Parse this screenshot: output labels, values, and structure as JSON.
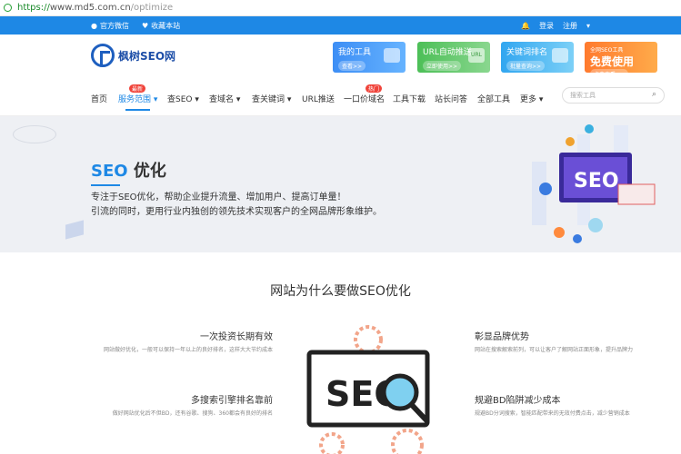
{
  "browser": {
    "url_proto": "https://",
    "url_host": "www.md5.com.cn",
    "url_path": "/optimize"
  },
  "topbar": {
    "wechat": "官方微信",
    "bookmark": "收藏本站",
    "login": "登录",
    "register": "注册"
  },
  "logo": {
    "text": "枫树SEO网"
  },
  "promos": [
    {
      "title": "我的工具",
      "sub": "查看>>"
    },
    {
      "title": "URL自动推送",
      "sub": "立即使用>>",
      "art": "URL"
    },
    {
      "title": "关键词排名",
      "sub": "批量查询>>"
    },
    {
      "title": "免费使用",
      "sub": "点击查看>>",
      "small": "全网SEO工具"
    }
  ],
  "nav": {
    "items": [
      "首页",
      "服务范围",
      "查SEO",
      "查域名",
      "查关键词",
      "URL推送",
      "一口价域名",
      "工具下载",
      "站长问答",
      "全部工具",
      "更多"
    ],
    "badge_new": "最新",
    "badge_hot": "热门",
    "search_placeholder": "搜索工具"
  },
  "hero": {
    "title_seo": "SEO",
    "title_rest": " 优化",
    "line1": "专注于SEO优化，帮助企业提升流量、增加用户、提高订单量！",
    "line2": "引流的同时，更用行业内独创的领先技术实现客户的全网品牌形象维护。",
    "art_text": "SEO"
  },
  "section": {
    "title": "网站为什么要做SEO优化",
    "art_text": "SEO",
    "reasons": [
      {
        "title": "一次投资长期有效",
        "desc": "网站做好优化，一般可以保持一年以上的良好排名，这样大大节约成本"
      },
      {
        "title": "彰显品牌优势",
        "desc": "网站在搜索解索前列，可以让客户了解网站正面形象，提升品牌力"
      },
      {
        "title": "多搜索引擎排名靠前",
        "desc": "做好网站优化后不但BD，还有谷歌、搜狗、360都会有良好的排名"
      },
      {
        "title": "规避BD陷阱减少成本",
        "desc": "规避BD分词搜索，智能匹配带来的无效付费点击，减少营销成本"
      }
    ]
  }
}
